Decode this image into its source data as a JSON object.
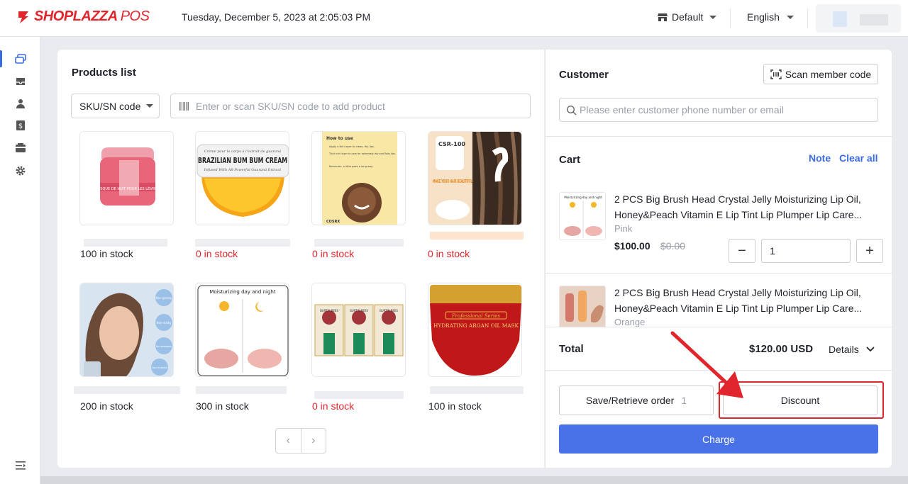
{
  "header": {
    "brand": "SHOPLAZZA",
    "brand_suffix": "POS",
    "datetime": "Tuesday, December 5, 2023 at 2:05:03 PM",
    "store": "Default",
    "language": "English"
  },
  "sidebar": {
    "items": [
      {
        "icon": "orders-icon",
        "active": true
      },
      {
        "icon": "inbox-icon"
      },
      {
        "icon": "customer-icon"
      },
      {
        "icon": "finance-icon"
      },
      {
        "icon": "wallet-icon"
      },
      {
        "icon": "settings-icon"
      }
    ],
    "bottom_icon": "collapse-menu-icon"
  },
  "products": {
    "title": "Products list",
    "filter_select": "SKU/SN code",
    "search_placeholder": "Enter or scan SKU/SN code to add product",
    "items": [
      {
        "stock": "100 in stock",
        "out": false
      },
      {
        "stock": "0 in stock",
        "out": true
      },
      {
        "stock": "0 in stock",
        "out": true
      },
      {
        "stock": "0 in stock",
        "out": true
      },
      {
        "stock": "200 in stock",
        "out": false
      },
      {
        "stock": "300 in stock",
        "out": false
      },
      {
        "stock": "0 in stock",
        "out": true
      },
      {
        "stock": "100 in stock",
        "out": false
      }
    ],
    "image_texts": {
      "p1": "MASQUE DE NUIT POUR LES LÈVRES",
      "p2a": "Crème pour le corps à l'extrait de guaraná",
      "p2b": "BRAZILIAN BUM BUM CREAM",
      "p2c": "Infused With All-Powerful Guaraná Extract",
      "p3a": "How to use",
      "p3b": "Apply a thin layer to clean, dry lips.",
      "p3c": "Thick rich layer to care for extremely dry and flaky lips.",
      "p3d": "Reminder, a little goes a long way.",
      "p3e": "COSRX",
      "p4a": "CSR-100",
      "p4b": "MAKE YOUR HAIR BEAUTIFUL",
      "p5a": "Non-greasy",
      "p5b": "Non-sticky",
      "p5c": "Non-comedogenic",
      "p5d": "Easy to absorb",
      "p6": "Moisturizing day and night",
      "p7": "BURT'S BEES",
      "p8a": "Professional Series",
      "p8b": "HYDRATING ARGAN OIL MASK"
    }
  },
  "customer": {
    "title": "Customer",
    "scan_button": "Scan member code",
    "search_placeholder": "Please enter customer phone number or email"
  },
  "cart": {
    "title": "Cart",
    "note": "Note",
    "clear_all": "Clear all",
    "items": [
      {
        "name": "2 PCS Big Brush Head Crystal Jelly Moisturizing Lip Oil, Honey&Peach Vitamin E Lip Tint Lip Plumper Lip Care...",
        "variant": "Pink",
        "price": "$100.00",
        "compare_price": "$0.00",
        "quantity": "1",
        "thumb_text": "Moisturizing day and night"
      },
      {
        "name": "2 PCS Big Brush Head Crystal Jelly Moisturizing Lip Oil, Honey&Peach Vitamin E Lip Tint Lip Plumper Lip Care...",
        "variant": "Orange"
      }
    ],
    "total_label": "Total",
    "total_value": "$120.00 USD",
    "details": "Details"
  },
  "actions": {
    "save_retrieve": "Save/Retrieve order",
    "save_count": "1",
    "discount": "Discount",
    "charge": "Charge"
  },
  "colors": {
    "brand": "#e0262c",
    "primary": "#4a72e8",
    "out_of_stock": "#e0262c"
  }
}
